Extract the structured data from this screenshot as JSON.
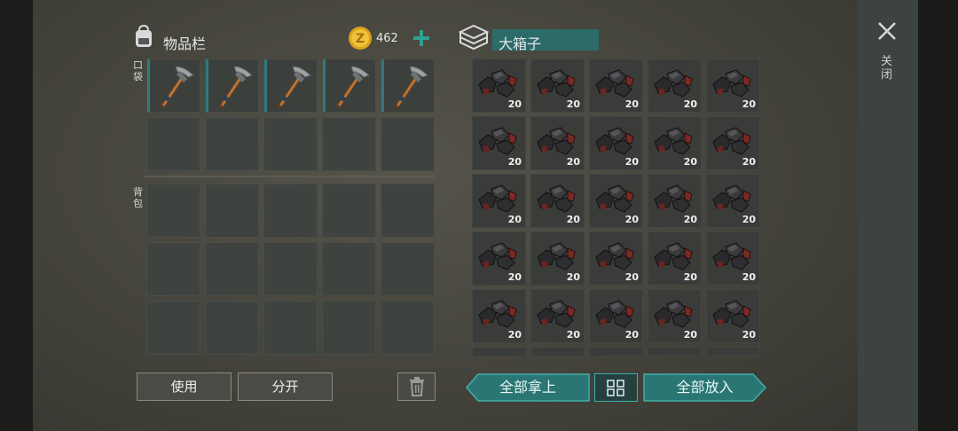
{
  "inventory": {
    "title": "物品栏",
    "coins": "462",
    "pocket_label": "口袋",
    "backpack_label": "背包",
    "use_label": "使用",
    "split_label": "分开"
  },
  "container": {
    "title": "大箱子",
    "stack_count": "20",
    "take_all_label": "全部拿上",
    "put_all_label": "全部放入"
  },
  "close_label": "关闭",
  "colors": {
    "accent": "#2e8f8a",
    "title_bg": "#2b6b6a"
  }
}
